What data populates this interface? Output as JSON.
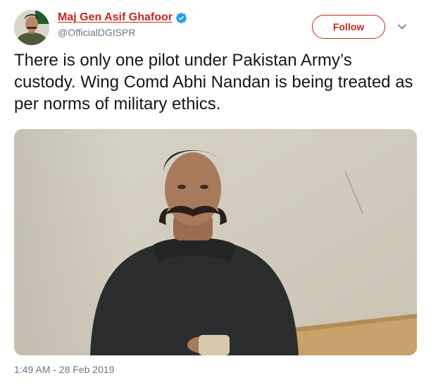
{
  "tweet": {
    "display_name": "Maj Gen Asif Ghafoor",
    "handle": "@OfficialDGISPR",
    "verified": true,
    "follow_label": "Follow",
    "text": "There is only one pilot under Pakistan Army’s custody. Wing Comd Abhi Nandan is being treated as per norms of military ethics.",
    "timestamp": "1:49 AM - 28 Feb 2019",
    "avatar_icon": "user-avatar-icon",
    "media_icon": "video-still-icon"
  },
  "colors": {
    "accent": "#c4261d",
    "verified": "#1da1f2",
    "text": "#14171a",
    "secondary_text": "#657786"
  }
}
